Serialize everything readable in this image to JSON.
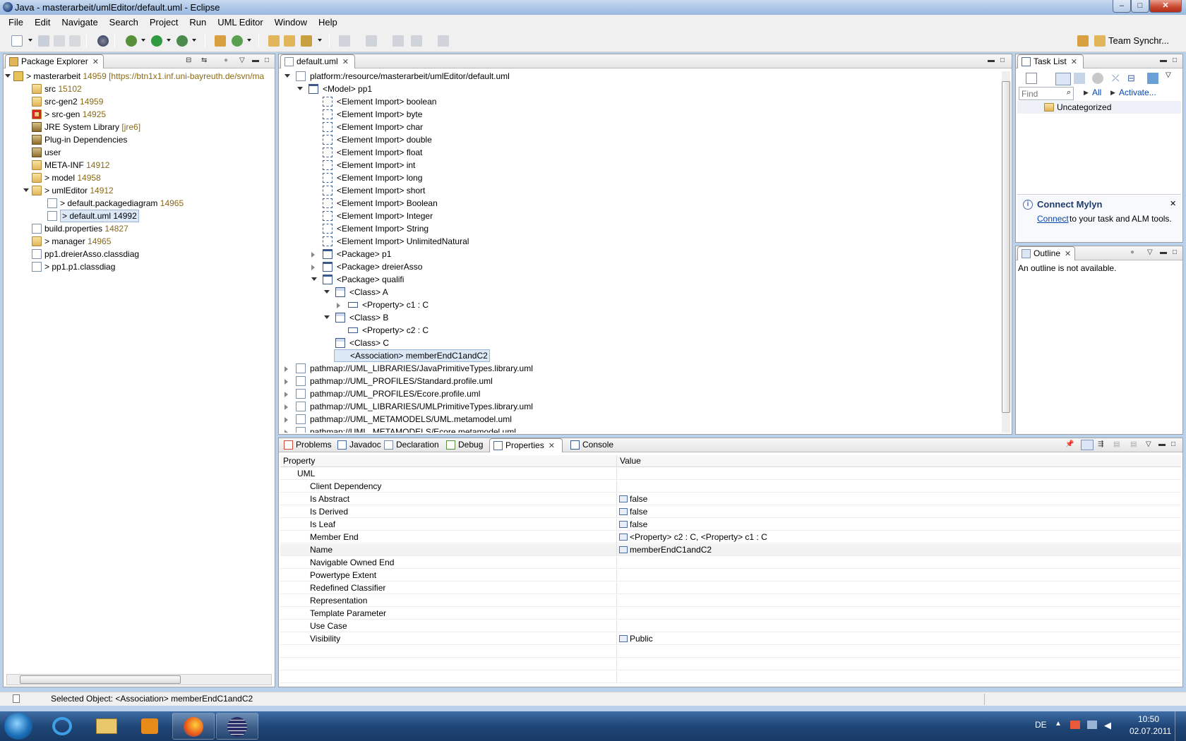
{
  "window": {
    "title": "Java - masterarbeit/umlEditor/default.uml - Eclipse",
    "min": "–",
    "max": "□",
    "close": "✕"
  },
  "menu": [
    "File",
    "Edit",
    "Navigate",
    "Search",
    "Project",
    "Run",
    "UML Editor",
    "Window",
    "Help"
  ],
  "toolbar": {
    "perspective_label": "Team Synchr..."
  },
  "package_explorer": {
    "tab": "Package Explorer",
    "items": [
      {
        "label": "> masterarbeit",
        "dec": " 14959 [https://btn1x1.inf.uni-bayreuth.de/svn/ma"
      },
      {
        "label": "src",
        "dec": " 15102"
      },
      {
        "label": "src-gen2",
        "dec": " 14959"
      },
      {
        "label": "> src-gen",
        "dec": " 14925"
      },
      {
        "label": "JRE System Library",
        "dec": " [jre6]"
      },
      {
        "label": "Plug-in Dependencies",
        "dec": ""
      },
      {
        "label": "user",
        "dec": ""
      },
      {
        "label": "META-INF",
        "dec": " 14912"
      },
      {
        "label": "> model",
        "dec": " 14958"
      },
      {
        "label": "> umlEditor",
        "dec": " 14912"
      },
      {
        "label": "> default.packagediagram",
        "dec": " 14965"
      },
      {
        "label": "> default.uml 14992",
        "dec": ""
      },
      {
        "label": "build.properties",
        "dec": " 14827"
      },
      {
        "label": "> manager",
        "dec": " 14965"
      },
      {
        "label": "pp1.dreierAsso.classdiag",
        "dec": ""
      },
      {
        "label": "> pp1.p1.classdiag",
        "dec": ""
      }
    ]
  },
  "editor": {
    "tab": "default.uml",
    "rows": [
      "platform:/resource/masterarbeit/umlEditor/default.uml",
      "<Model> pp1",
      "<Element Import> boolean",
      "<Element Import> byte",
      "<Element Import> char",
      "<Element Import> double",
      "<Element Import> float",
      "<Element Import> int",
      "<Element Import> long",
      "<Element Import> short",
      "<Element Import> Boolean",
      "<Element Import> Integer",
      "<Element Import> String",
      "<Element Import> UnlimitedNatural",
      "<Package> p1",
      "<Package> dreierAsso",
      "<Package> qualifi",
      "<Class> A",
      "<Property> c1 : C",
      "<Class> B",
      "<Property> c2 : C",
      "<Class> C",
      "<Association> memberEndC1andC2",
      "pathmap://UML_LIBRARIES/JavaPrimitiveTypes.library.uml",
      "pathmap://UML_PROFILES/Standard.profile.uml",
      "pathmap://UML_PROFILES/Ecore.profile.uml",
      "pathmap://UML_LIBRARIES/UMLPrimitiveTypes.library.uml",
      "pathmap://UML_METAMODELS/UML.metamodel.uml",
      "pathmap://UML_METAMODELS/Ecore.metamodel.uml"
    ]
  },
  "task_list": {
    "tab": "Task List",
    "find_placeholder": "Find",
    "all": "All",
    "activate": "Activate...",
    "category": "Uncategorized",
    "mylyn_title": "Connect Mylyn",
    "mylyn_link": "Connect",
    "mylyn_text": " to your task and ALM tools."
  },
  "outline": {
    "tab": "Outline",
    "message": "An outline is not available."
  },
  "bottom_tabs": [
    "Problems",
    "Javadoc",
    "Declaration",
    "Debug",
    "Properties",
    "Console"
  ],
  "properties": {
    "col_property": "Property",
    "col_value": "Value",
    "category": "UML",
    "rows": [
      {
        "name": "Client Dependency",
        "value": ""
      },
      {
        "name": "Is Abstract",
        "value": "false"
      },
      {
        "name": "Is Derived",
        "value": "false"
      },
      {
        "name": "Is Leaf",
        "value": "false"
      },
      {
        "name": "Member End",
        "value": "<Property> c2 : C, <Property> c1 : C"
      },
      {
        "name": "Name",
        "value": "memberEndC1andC2"
      },
      {
        "name": "Navigable Owned End",
        "value": ""
      },
      {
        "name": "Powertype Extent",
        "value": ""
      },
      {
        "name": "Redefined Classifier",
        "value": ""
      },
      {
        "name": "Representation",
        "value": ""
      },
      {
        "name": "Template Parameter",
        "value": ""
      },
      {
        "name": "Use Case",
        "value": ""
      },
      {
        "name": "Visibility",
        "value": "Public"
      }
    ]
  },
  "status": {
    "text": "Selected Object: <Association> memberEndC1andC2"
  },
  "taskbar": {
    "lang": "DE",
    "time": "10:50",
    "date": "02.07.2011"
  },
  "colors": {
    "selection": "#dde8f7",
    "decoration": "#8a6a1a",
    "link": "#0645ad"
  }
}
